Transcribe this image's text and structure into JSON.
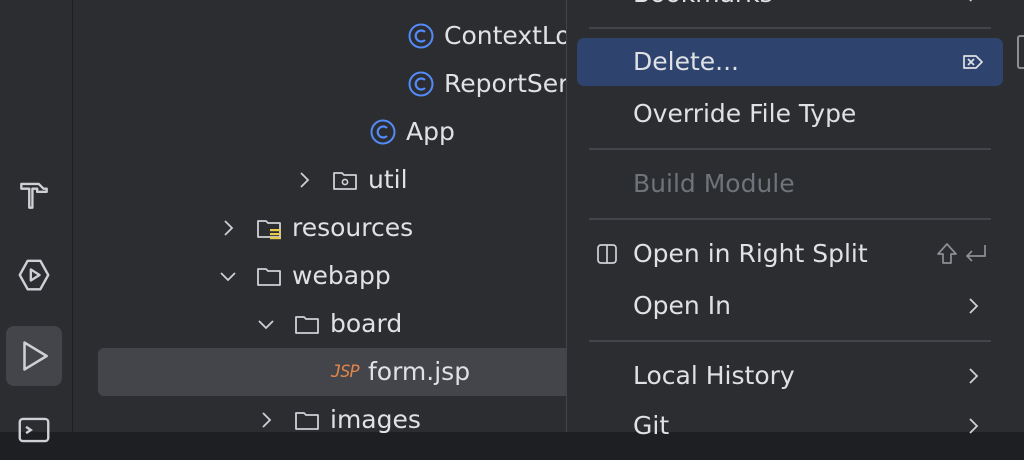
{
  "toolstrip": {
    "icons": [
      "build-hammer-icon",
      "services-icon",
      "run-icon",
      "terminal-icon"
    ]
  },
  "tree": {
    "rows": [
      {
        "label": "ContextLo",
        "kind": "class"
      },
      {
        "label": "ReportSer",
        "kind": "class"
      },
      {
        "label": "App",
        "kind": "class"
      },
      {
        "label": "util",
        "kind": "package"
      },
      {
        "label": "resources",
        "kind": "resources-folder"
      },
      {
        "label": "webapp",
        "kind": "folder"
      },
      {
        "label": "board",
        "kind": "folder"
      },
      {
        "label": "form.jsp",
        "kind": "jsp"
      },
      {
        "label": "images",
        "kind": "folder"
      }
    ],
    "jsp_badge": "JSP",
    "class_color": "#548af7",
    "jsp_color": "#e0864b"
  },
  "menu": {
    "top_partial": "Bookmarks",
    "delete": "Delete...",
    "override_file_type": "Override File Type",
    "build_module": "Build Module",
    "open_in_right_split": "Open in Right Split",
    "open_in": "Open In",
    "local_history": "Local History",
    "git": "Git",
    "highlight_color": "#2e436e"
  }
}
